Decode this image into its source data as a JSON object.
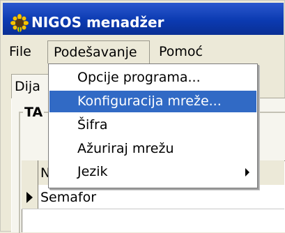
{
  "window": {
    "title": "NIGOS menadžer",
    "icon": "sunflower-icon"
  },
  "menubar": {
    "file": "File",
    "podesavanje": "Podešavanje",
    "pomoc": "Pomoć"
  },
  "tabs": [
    "Dija"
  ],
  "group": {
    "label": "TA"
  },
  "grid": {
    "column_header": "N",
    "rows": [
      "Semafor"
    ]
  },
  "dropdown": {
    "items": [
      {
        "label": "Opcije programa..."
      },
      {
        "label": "Konfiguracija mreže..."
      },
      {
        "label": "Šifra"
      },
      {
        "label": "Ažuriraj mrežu"
      },
      {
        "label": "Jezik"
      }
    ],
    "selected_index": 1,
    "submenu_index": 4
  },
  "colors": {
    "titlebar": "#0b3ab1",
    "selection": "#316ac5",
    "menu_bg": "#ece9d8"
  }
}
